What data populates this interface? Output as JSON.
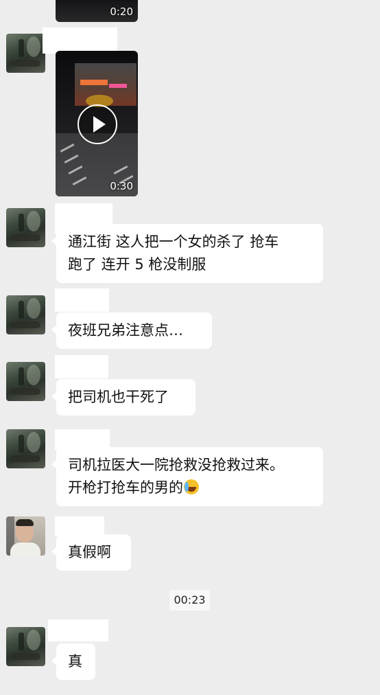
{
  "chat": {
    "videos": [
      {
        "duration": "0:20"
      },
      {
        "duration": "0:30"
      }
    ],
    "messages": [
      {
        "line1": "通江街 这人把一个女的杀了 抢车",
        "line2": "跑了 连开 5 枪没制服"
      },
      {
        "line1": "夜班兄弟注意点…"
      },
      {
        "line1": "把司机也干死了"
      },
      {
        "line1": "司机拉医大一院抢救没抢救过来。",
        "line2": "开枪打抢车的男的"
      },
      {
        "line1": "真假啊"
      },
      {
        "line1": "真"
      }
    ],
    "timestamp": "00:23",
    "emoji_icon": "crying-laughing-emoji-icon"
  }
}
